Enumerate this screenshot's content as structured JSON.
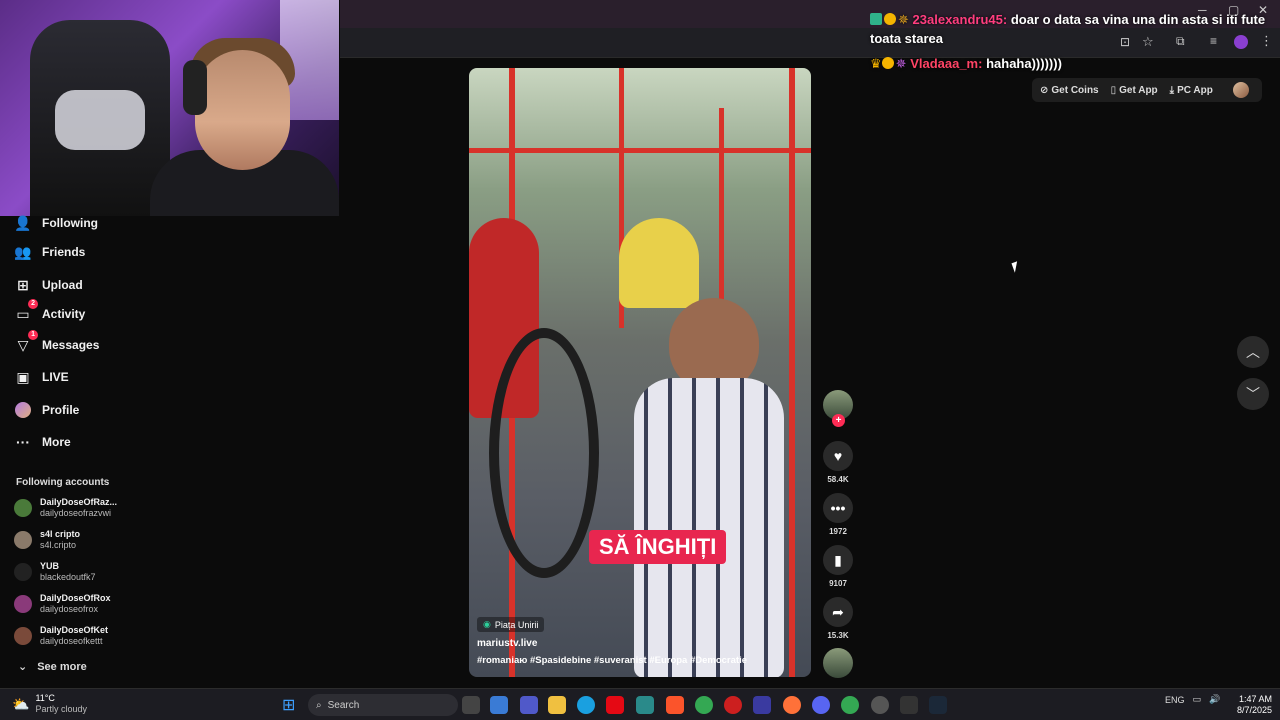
{
  "chat": {
    "line1_user": "23alexandru45:",
    "line1_text": "doar o data sa vina una din asta si iti fute toata starea",
    "line2_user": "Vladaaa_m:",
    "line2_text": "hahaha)))))))"
  },
  "topbar": {
    "get_coins": "Get Coins",
    "get_app": "Get App",
    "pc_app": "PC App"
  },
  "nav": {
    "following": "Following",
    "friends": "Friends",
    "upload": "Upload",
    "activity": "Activity",
    "activity_badge": "2",
    "messages": "Messages",
    "messages_badge": "1",
    "live": "LIVE",
    "profile": "Profile",
    "more": "More"
  },
  "following_accounts": {
    "title": "Following accounts",
    "items": [
      {
        "name": "DailyDoseOfRaz...",
        "handle": "dailydoseofrazvwi"
      },
      {
        "name": "s4l cripto",
        "handle": "s4l.cripto"
      },
      {
        "name": "YUB",
        "handle": "blackedoutfk7"
      },
      {
        "name": "DailyDoseOfRox",
        "handle": "dailydoseofrox"
      },
      {
        "name": "DailyDoseOfKet",
        "handle": "dailydoseofkettt"
      }
    ],
    "see_more": "See more"
  },
  "video": {
    "caption": "SĂ ÎNGHIȚI",
    "location": "Piața Unirii",
    "author": "mariustv.live",
    "hashtags": "#romaniaю #Spasidebine #suveranist #Europa #Democratie"
  },
  "actions": {
    "likes": "58.4K",
    "comments": "1972",
    "saves": "9107",
    "shares": "15.3K"
  },
  "taskbar": {
    "temp": "11°C",
    "weather": "Partly cloudy",
    "search": "Search",
    "lang": "ENG",
    "time": "1:47 AM",
    "date": "8/7/2025"
  }
}
